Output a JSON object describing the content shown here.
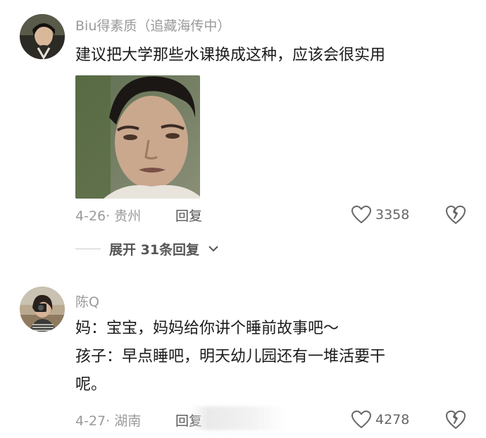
{
  "comments": [
    {
      "username": "Biu得素质（追藏海传中）",
      "text": "建议把大学那些水课换成这种，应该会很实用",
      "date": "4-26· 贵州",
      "reply_label": "回复",
      "likes": "3358",
      "expand_label": "展开 31条回复"
    },
    {
      "username": "陈Q",
      "lines": [
        "妈：宝宝，妈妈给你讲个睡前故事吧～",
        "孩子：早点睡吧，明天幼儿园还有一堆活要干",
        "呢。"
      ],
      "date": "4-27· 湖南",
      "reply_label": "回复",
      "likes": "4278"
    }
  ],
  "icons": {
    "like": "heart-outline-icon",
    "dislike": "broken-heart-icon",
    "expand": "chevron-down-icon"
  },
  "colors": {
    "meta_text": "#9a9a9a",
    "body_text": "#1a1a1a",
    "reply_text": "#555555"
  }
}
